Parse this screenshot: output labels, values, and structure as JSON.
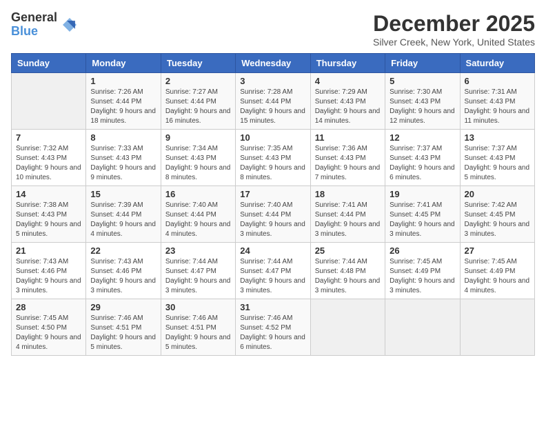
{
  "logo": {
    "general": "General",
    "blue": "Blue"
  },
  "title": "December 2025",
  "location": "Silver Creek, New York, United States",
  "days_of_week": [
    "Sunday",
    "Monday",
    "Tuesday",
    "Wednesday",
    "Thursday",
    "Friday",
    "Saturday"
  ],
  "weeks": [
    [
      {
        "day": "",
        "sunrise": "",
        "sunset": "",
        "daylight": ""
      },
      {
        "day": "1",
        "sunrise": "Sunrise: 7:26 AM",
        "sunset": "Sunset: 4:44 PM",
        "daylight": "Daylight: 9 hours and 18 minutes."
      },
      {
        "day": "2",
        "sunrise": "Sunrise: 7:27 AM",
        "sunset": "Sunset: 4:44 PM",
        "daylight": "Daylight: 9 hours and 16 minutes."
      },
      {
        "day": "3",
        "sunrise": "Sunrise: 7:28 AM",
        "sunset": "Sunset: 4:44 PM",
        "daylight": "Daylight: 9 hours and 15 minutes."
      },
      {
        "day": "4",
        "sunrise": "Sunrise: 7:29 AM",
        "sunset": "Sunset: 4:43 PM",
        "daylight": "Daylight: 9 hours and 14 minutes."
      },
      {
        "day": "5",
        "sunrise": "Sunrise: 7:30 AM",
        "sunset": "Sunset: 4:43 PM",
        "daylight": "Daylight: 9 hours and 12 minutes."
      },
      {
        "day": "6",
        "sunrise": "Sunrise: 7:31 AM",
        "sunset": "Sunset: 4:43 PM",
        "daylight": "Daylight: 9 hours and 11 minutes."
      }
    ],
    [
      {
        "day": "7",
        "sunrise": "Sunrise: 7:32 AM",
        "sunset": "Sunset: 4:43 PM",
        "daylight": "Daylight: 9 hours and 10 minutes."
      },
      {
        "day": "8",
        "sunrise": "Sunrise: 7:33 AM",
        "sunset": "Sunset: 4:43 PM",
        "daylight": "Daylight: 9 hours and 9 minutes."
      },
      {
        "day": "9",
        "sunrise": "Sunrise: 7:34 AM",
        "sunset": "Sunset: 4:43 PM",
        "daylight": "Daylight: 9 hours and 8 minutes."
      },
      {
        "day": "10",
        "sunrise": "Sunrise: 7:35 AM",
        "sunset": "Sunset: 4:43 PM",
        "daylight": "Daylight: 9 hours and 8 minutes."
      },
      {
        "day": "11",
        "sunrise": "Sunrise: 7:36 AM",
        "sunset": "Sunset: 4:43 PM",
        "daylight": "Daylight: 9 hours and 7 minutes."
      },
      {
        "day": "12",
        "sunrise": "Sunrise: 7:37 AM",
        "sunset": "Sunset: 4:43 PM",
        "daylight": "Daylight: 9 hours and 6 minutes."
      },
      {
        "day": "13",
        "sunrise": "Sunrise: 7:37 AM",
        "sunset": "Sunset: 4:43 PM",
        "daylight": "Daylight: 9 hours and 5 minutes."
      }
    ],
    [
      {
        "day": "14",
        "sunrise": "Sunrise: 7:38 AM",
        "sunset": "Sunset: 4:43 PM",
        "daylight": "Daylight: 9 hours and 5 minutes."
      },
      {
        "day": "15",
        "sunrise": "Sunrise: 7:39 AM",
        "sunset": "Sunset: 4:44 PM",
        "daylight": "Daylight: 9 hours and 4 minutes."
      },
      {
        "day": "16",
        "sunrise": "Sunrise: 7:40 AM",
        "sunset": "Sunset: 4:44 PM",
        "daylight": "Daylight: 9 hours and 4 minutes."
      },
      {
        "day": "17",
        "sunrise": "Sunrise: 7:40 AM",
        "sunset": "Sunset: 4:44 PM",
        "daylight": "Daylight: 9 hours and 3 minutes."
      },
      {
        "day": "18",
        "sunrise": "Sunrise: 7:41 AM",
        "sunset": "Sunset: 4:44 PM",
        "daylight": "Daylight: 9 hours and 3 minutes."
      },
      {
        "day": "19",
        "sunrise": "Sunrise: 7:41 AM",
        "sunset": "Sunset: 4:45 PM",
        "daylight": "Daylight: 9 hours and 3 minutes."
      },
      {
        "day": "20",
        "sunrise": "Sunrise: 7:42 AM",
        "sunset": "Sunset: 4:45 PM",
        "daylight": "Daylight: 9 hours and 3 minutes."
      }
    ],
    [
      {
        "day": "21",
        "sunrise": "Sunrise: 7:43 AM",
        "sunset": "Sunset: 4:46 PM",
        "daylight": "Daylight: 9 hours and 3 minutes."
      },
      {
        "day": "22",
        "sunrise": "Sunrise: 7:43 AM",
        "sunset": "Sunset: 4:46 PM",
        "daylight": "Daylight: 9 hours and 3 minutes."
      },
      {
        "day": "23",
        "sunrise": "Sunrise: 7:44 AM",
        "sunset": "Sunset: 4:47 PM",
        "daylight": "Daylight: 9 hours and 3 minutes."
      },
      {
        "day": "24",
        "sunrise": "Sunrise: 7:44 AM",
        "sunset": "Sunset: 4:47 PM",
        "daylight": "Daylight: 9 hours and 3 minutes."
      },
      {
        "day": "25",
        "sunrise": "Sunrise: 7:44 AM",
        "sunset": "Sunset: 4:48 PM",
        "daylight": "Daylight: 9 hours and 3 minutes."
      },
      {
        "day": "26",
        "sunrise": "Sunrise: 7:45 AM",
        "sunset": "Sunset: 4:49 PM",
        "daylight": "Daylight: 9 hours and 3 minutes."
      },
      {
        "day": "27",
        "sunrise": "Sunrise: 7:45 AM",
        "sunset": "Sunset: 4:49 PM",
        "daylight": "Daylight: 9 hours and 4 minutes."
      }
    ],
    [
      {
        "day": "28",
        "sunrise": "Sunrise: 7:45 AM",
        "sunset": "Sunset: 4:50 PM",
        "daylight": "Daylight: 9 hours and 4 minutes."
      },
      {
        "day": "29",
        "sunrise": "Sunrise: 7:46 AM",
        "sunset": "Sunset: 4:51 PM",
        "daylight": "Daylight: 9 hours and 5 minutes."
      },
      {
        "day": "30",
        "sunrise": "Sunrise: 7:46 AM",
        "sunset": "Sunset: 4:51 PM",
        "daylight": "Daylight: 9 hours and 5 minutes."
      },
      {
        "day": "31",
        "sunrise": "Sunrise: 7:46 AM",
        "sunset": "Sunset: 4:52 PM",
        "daylight": "Daylight: 9 hours and 6 minutes."
      },
      {
        "day": "",
        "sunrise": "",
        "sunset": "",
        "daylight": ""
      },
      {
        "day": "",
        "sunrise": "",
        "sunset": "",
        "daylight": ""
      },
      {
        "day": "",
        "sunrise": "",
        "sunset": "",
        "daylight": ""
      }
    ]
  ]
}
